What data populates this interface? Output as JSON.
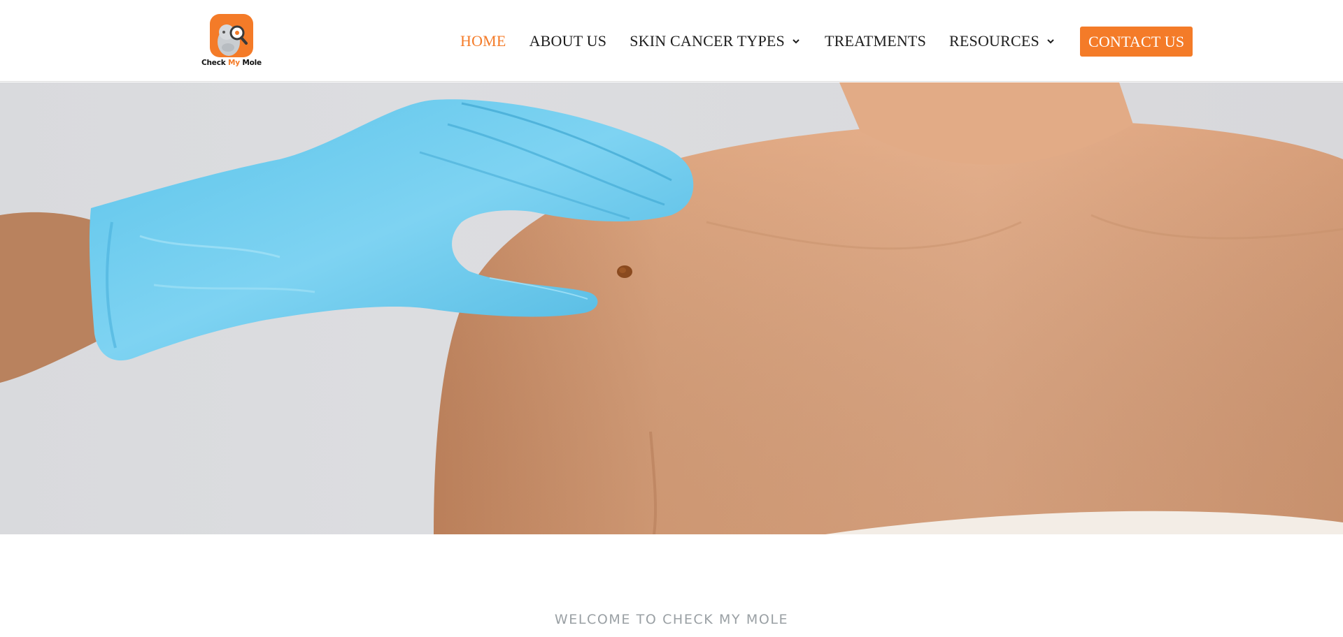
{
  "brand": {
    "logo_text_prefix": "Check ",
    "logo_text_accent": "My",
    "logo_text_suffix": " Mole",
    "accent_color": "#f47b28"
  },
  "nav": {
    "items": [
      {
        "label": "HOME",
        "active": true,
        "has_dropdown": false
      },
      {
        "label": "ABOUT US",
        "active": false,
        "has_dropdown": false
      },
      {
        "label": "SKIN CANCER TYPES",
        "active": false,
        "has_dropdown": true
      },
      {
        "label": "TREATMENTS",
        "active": false,
        "has_dropdown": false
      },
      {
        "label": "RESOURCES",
        "active": false,
        "has_dropdown": true
      }
    ],
    "cta_label": "CONTACT US"
  },
  "hero": {
    "image_icon": "gloved-hand-examining-mole-image"
  },
  "intro": {
    "eyebrow": "WELCOME TO CHECK MY MOLE"
  }
}
